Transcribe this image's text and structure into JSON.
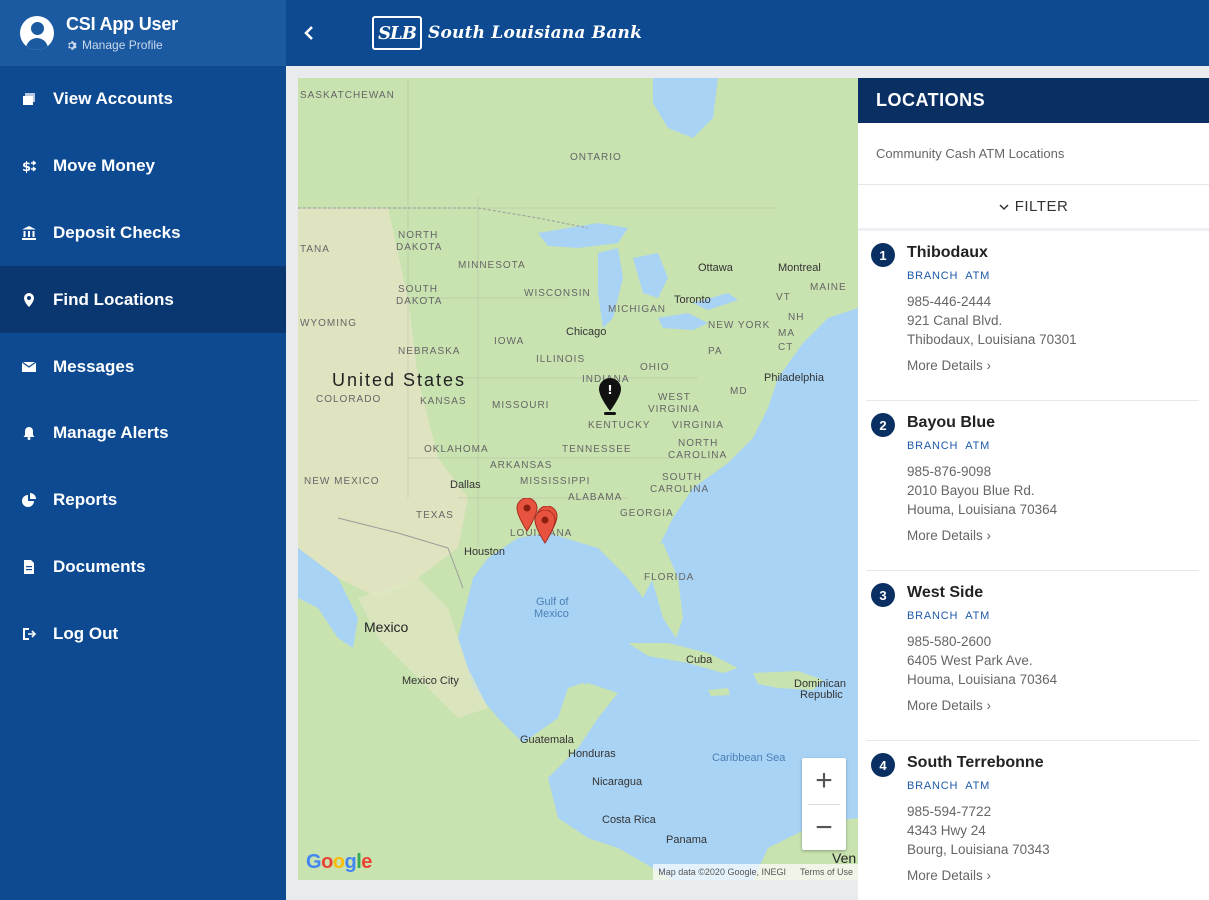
{
  "profile": {
    "name": "CSI App User",
    "manage_label": "Manage Profile"
  },
  "nav": [
    {
      "label": "View Accounts",
      "icon": "accounts-icon",
      "active": false
    },
    {
      "label": "Move Money",
      "icon": "transfer-icon",
      "active": false
    },
    {
      "label": "Deposit Checks",
      "icon": "bank-icon",
      "active": false
    },
    {
      "label": "Find Locations",
      "icon": "location-pin-icon",
      "active": true
    },
    {
      "label": "Messages",
      "icon": "envelope-icon",
      "active": false
    },
    {
      "label": "Manage Alerts",
      "icon": "bell-icon",
      "active": false
    },
    {
      "label": "Reports",
      "icon": "pie-chart-icon",
      "active": false
    },
    {
      "label": "Documents",
      "icon": "document-icon",
      "active": false
    },
    {
      "label": "Log Out",
      "icon": "logout-icon",
      "active": false
    }
  ],
  "header": {
    "logo_mark": "SLB",
    "bank_name": "South Louisiana Bank"
  },
  "map": {
    "labels": {
      "saskatchewan": "SASKATCHEWAN",
      "ontario": "ONTARIO",
      "montana": "TANA",
      "north_dakota_1": "NORTH",
      "north_dakota_2": "DAKOTA",
      "minnesota": "MINNESOTA",
      "south_dakota_1": "SOUTH",
      "south_dakota_2": "DAKOTA",
      "wisconsin": "WISCONSIN",
      "michigan": "MICHIGAN",
      "wyoming": "WYOMING",
      "iowa": "IOWA",
      "nebraska": "NEBRASKA",
      "illinois": "ILLINOIS",
      "ohio": "OHIO",
      "united_states": "United States",
      "indiana": "INDIANA",
      "colorado": "COLORADO",
      "kansas": "KANSAS",
      "missouri": "MISSOURI",
      "west_virginia_1": "WEST",
      "west_virginia_2": "VIRGINIA",
      "kentucky": "KENTUCKY",
      "virginia": "VIRGINIA",
      "oklahoma": "OKLAHOMA",
      "tennessee": "TENNESSEE",
      "north_carolina_1": "NORTH",
      "north_carolina_2": "CAROLINA",
      "new_mexico": "NEW MEXICO",
      "arkansas": "ARKANSAS",
      "mississippi": "MISSISSIPPI",
      "south_carolina_1": "SOUTH",
      "south_carolina_2": "CAROLINA",
      "alabama": "ALABAMA",
      "georgia": "GEORGIA",
      "texas": "TEXAS",
      "louisiana": "LOUISIANA",
      "florida": "FLORIDA",
      "new_york": "NEW YORK",
      "maine": "MAINE",
      "vt": "VT",
      "nh": "NH",
      "ma": "MA",
      "pa": "PA",
      "md": "MD",
      "ct": "CT",
      "gulf_1": "Gulf of",
      "gulf_2": "Mexico",
      "caribbean": "Caribbean Sea",
      "mexico": "Mexico",
      "cuba": "Cuba",
      "dominican_1": "Dominican",
      "dominican_2": "Republic",
      "guatemala": "Guatemala",
      "honduras": "Honduras",
      "nicaragua": "Nicaragua",
      "costa_rica": "Costa Rica",
      "panama": "Panama",
      "venezuela": "Ven"
    },
    "cities": {
      "ottawa": "Ottawa",
      "montreal": "Montreal",
      "toronto": "Toronto",
      "chicago": "Chicago",
      "philadelphia": "Philadelphia",
      "dallas": "Dallas",
      "houston": "Houston",
      "mexico_city": "Mexico City"
    },
    "attribution": {
      "data": "Map data ©2020 Google, INEGI",
      "terms": "Terms of Use"
    },
    "zoom_in": "+",
    "zoom_out": "−",
    "google_letters": [
      "G",
      "o",
      "o",
      "g",
      "l",
      "e"
    ]
  },
  "panel": {
    "title": "LOCATIONS",
    "subtitle": "Community Cash ATM Locations",
    "filter_label": "FILTER",
    "locations": [
      {
        "num": "1",
        "name": "Thibodaux",
        "tag1": "BRANCH",
        "tag2": "ATM",
        "phone": "985-446-2444",
        "address1": "921 Canal Blvd.",
        "address2": "Thibodaux, Louisiana 70301",
        "more": "More Details"
      },
      {
        "num": "2",
        "name": "Bayou Blue",
        "tag1": "BRANCH",
        "tag2": "ATM",
        "phone": "985-876-9098",
        "address1": "2010 Bayou Blue Rd.",
        "address2": "Houma, Louisiana 70364",
        "more": "More Details"
      },
      {
        "num": "3",
        "name": "West Side",
        "tag1": "BRANCH",
        "tag2": "ATM",
        "phone": "985-580-2600",
        "address1": "6405 West Park Ave.",
        "address2": "Houma, Louisiana 70364",
        "more": "More Details"
      },
      {
        "num": "4",
        "name": "South Terrebonne",
        "tag1": "BRANCH",
        "tag2": "ATM",
        "phone": "985-594-7722",
        "address1": "4343 Hwy 24",
        "address2": "Bourg, Louisiana 70343",
        "more": "More Details"
      }
    ]
  }
}
